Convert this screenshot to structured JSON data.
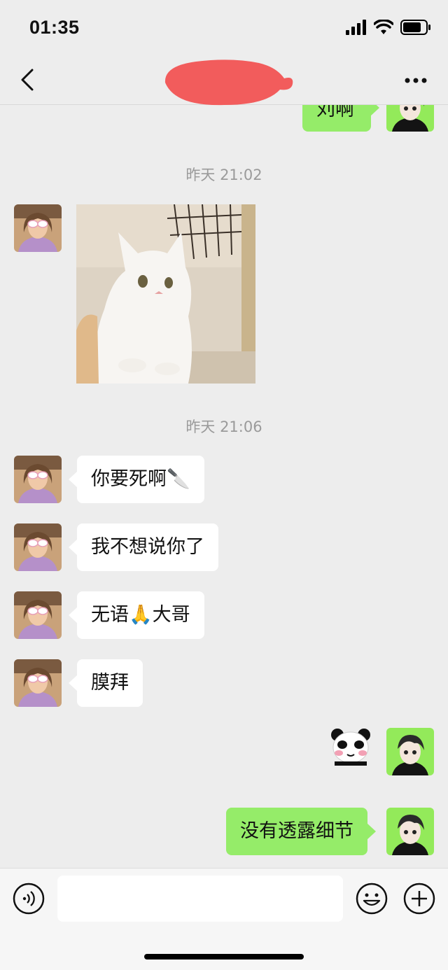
{
  "status_bar": {
    "time": "01:35"
  },
  "nav": {
    "back_icon": "chevron-left-icon",
    "more_icon": "more-dots-icon"
  },
  "messages": {
    "top_partial": "刘啊",
    "timestamp1": "昨天 21:02",
    "timestamp2": "昨天 21:06",
    "m1": "你要死啊🔪",
    "m2": "我不想说你了",
    "m3": "无语🙏大哥",
    "m4": "膜拜",
    "m5": "没有透露细节"
  },
  "input": {
    "placeholder": ""
  },
  "icons": [
    "voice-icon",
    "emoji-icon",
    "plus-icon"
  ],
  "colors": {
    "background": "#ededed",
    "sent_bubble": "#95ec69",
    "received_bubble": "#ffffff",
    "timestamp": "#9a9a9a"
  }
}
